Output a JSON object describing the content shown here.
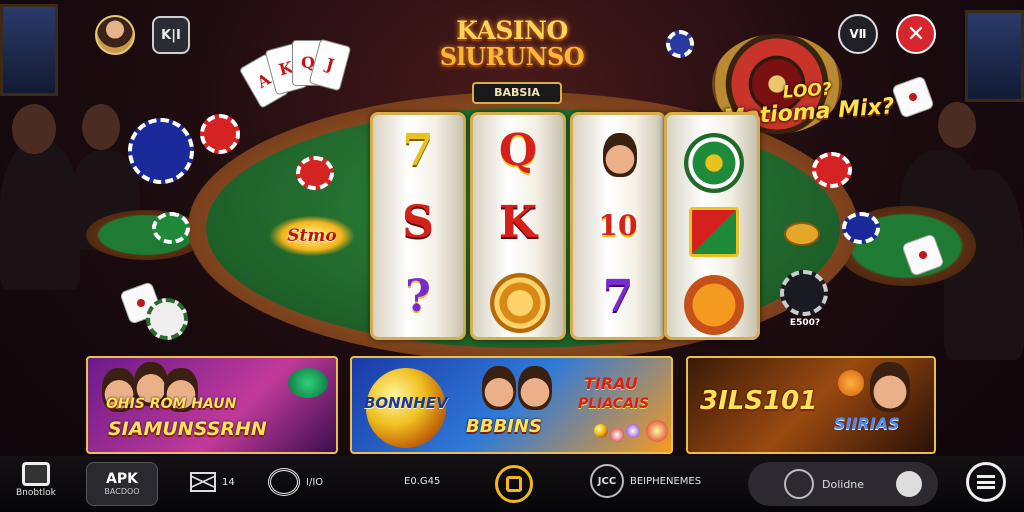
{
  "header": {
    "tool_label": "K|I",
    "info_label": "ⅤⅡ",
    "close_label": "✕"
  },
  "logo": {
    "line1": "KASINO",
    "line2": "SlURUNSO",
    "subtitle": "BABSIA"
  },
  "slot": {
    "reels": [
      {
        "top": "7",
        "middle": "S",
        "bottom": "?"
      },
      {
        "top": "Q",
        "middle": "K",
        "bottom": ""
      },
      {
        "top": "",
        "middle": "10",
        "bottom": "7"
      },
      {
        "top": "",
        "middle": "",
        "bottom": ""
      }
    ],
    "reel_colors": [
      "#e8c21e",
      "#d6201c",
      "#7a2ad0",
      "#1e8a3a"
    ],
    "badge": "Stmo"
  },
  "promo": {
    "line1": "LOO?",
    "line2": "Matioma Mix?"
  },
  "chip_value": "E500?",
  "banners": [
    {
      "title_1": "OHIS ROM HAUN",
      "title_2": "SIAMUNSSRHN"
    },
    {
      "title_1": "BONNHEV",
      "title_2": "BBBINS",
      "title_3": "TIRAU",
      "title_4": "PLIACAIS"
    },
    {
      "title_1": "3ILS101",
      "title_2": "SIIRIAS"
    }
  ],
  "bottom_nav": {
    "home_label": "Bnobtlok",
    "apk_label": "APK",
    "apk_sub": "BACDOO",
    "mail_label": "14",
    "wifi_label": "I/IO",
    "balance": "E0.G45",
    "rank_badge": "JCC",
    "rank_label": "BEIPHENEMES",
    "pill_label": "Dolidne"
  },
  "colors": {
    "accent_gold": "#e9c04a",
    "close_red": "#d7262e",
    "felt_green": "#2f8a3c"
  }
}
